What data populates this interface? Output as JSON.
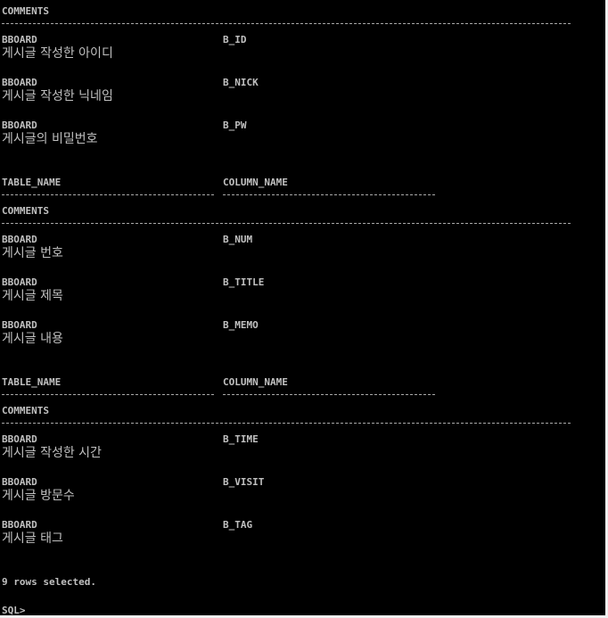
{
  "terminal": {
    "header_label": "COMMENTS",
    "blocks": [
      {
        "rows": [
          {
            "table": "BBOARD",
            "column": "B_ID",
            "comment": "게시글 작성한 아이디"
          },
          {
            "table": "BBOARD",
            "column": "B_NICK",
            "comment": "게시글 작성한 닉네임"
          },
          {
            "table": "BBOARD",
            "column": "B_PW",
            "comment": "게시글의 비밀번호"
          }
        ]
      },
      {
        "header": {
          "table_name": "TABLE_NAME",
          "column_name": "COLUMN_NAME",
          "comments": "COMMENTS"
        },
        "rows": [
          {
            "table": "BBOARD",
            "column": "B_NUM",
            "comment": "게시글 번호"
          },
          {
            "table": "BBOARD",
            "column": "B_TITLE",
            "comment": "게시글 제목"
          },
          {
            "table": "BBOARD",
            "column": "B_MEMO",
            "comment": "게시글 내용"
          }
        ]
      },
      {
        "header": {
          "table_name": "TABLE_NAME",
          "column_name": "COLUMN_NAME",
          "comments": "COMMENTS"
        },
        "rows": [
          {
            "table": "BBOARD",
            "column": "B_TIME",
            "comment": "게시글 작성한 시간"
          },
          {
            "table": "BBOARD",
            "column": "B_VISIT",
            "comment": "게시글 방문수"
          },
          {
            "table": "BBOARD",
            "column": "B_TAG",
            "comment": "게시글 태그"
          }
        ]
      }
    ],
    "rows_selected": "9 rows selected.",
    "prompt": "SQL>"
  }
}
